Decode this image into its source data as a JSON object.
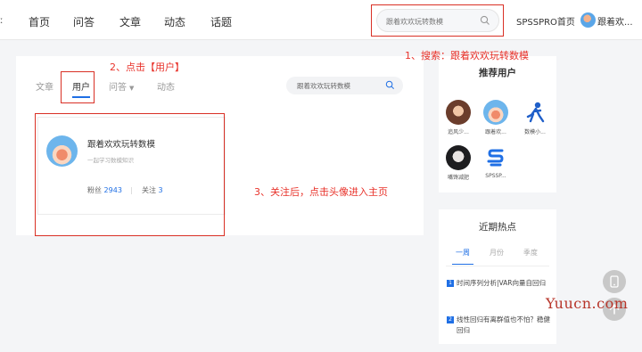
{
  "topbar": {
    "edge_glyph": "ː",
    "nav": [
      {
        "label": "首页"
      },
      {
        "label": "问答"
      },
      {
        "label": "文章"
      },
      {
        "label": "动态"
      },
      {
        "label": "话题"
      }
    ],
    "search_value": "跟着欢欢玩转数模",
    "brand_link": "SPSSPRO首页",
    "user_name": "跟着欢..."
  },
  "main": {
    "tabs": [
      {
        "label": "文章"
      },
      {
        "label": "用户"
      },
      {
        "label": "问答"
      },
      {
        "label": "动态"
      }
    ],
    "inner_search_value": "跟着欢欢玩转数模",
    "user_card": {
      "name": "跟着欢欢玩转数模",
      "desc": "一起学习数模知识",
      "fans_label": "粉丝",
      "fans_count": "2943",
      "follow_label": "关注",
      "follow_count": "3"
    }
  },
  "recommend": {
    "title": "推荐用户",
    "users": [
      {
        "name": "追风少..."
      },
      {
        "name": "跟着欢..."
      },
      {
        "name": "数模小..."
      },
      {
        "name": "嘴馋减肥"
      },
      {
        "name": "SPSSP..."
      }
    ]
  },
  "hot": {
    "title": "近期热点",
    "tabs": [
      {
        "label": "一周"
      },
      {
        "label": "月份"
      },
      {
        "label": "季度"
      }
    ],
    "items": [
      {
        "rank": "1",
        "text": "时间序列分析|VAR向量自回归"
      },
      {
        "rank": "2",
        "text": "线性回归有离群值也不怕？稳健回归"
      }
    ]
  },
  "annotations": {
    "step1": "1、搜索：跟着欢欢玩转数模",
    "step2": "2、点击【用户】",
    "step3": "3、关注后，点击头像进入主页"
  },
  "watermark": "Yuucn.com",
  "colors": {
    "accent": "#1f6fe5",
    "annotation": "#e8322a"
  }
}
